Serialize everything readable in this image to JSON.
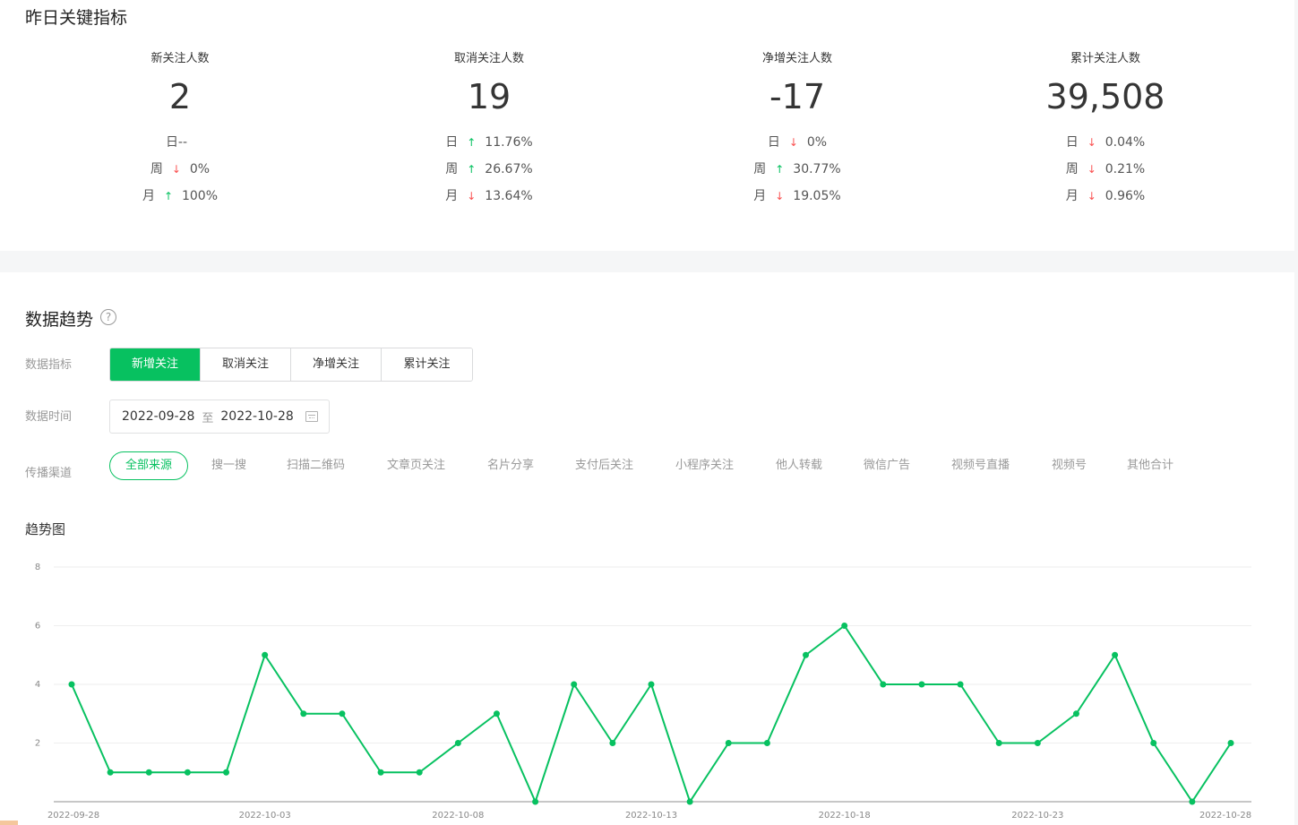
{
  "top": {
    "title": "昨日关键指标",
    "kpis": [
      {
        "label": "新关注人数",
        "value": "2",
        "rows": [
          {
            "period": "日--",
            "dir": "",
            "pct": ""
          },
          {
            "period": "周",
            "dir": "down",
            "pct": "0%"
          },
          {
            "period": "月",
            "dir": "up",
            "pct": "100%"
          }
        ]
      },
      {
        "label": "取消关注人数",
        "value": "19",
        "rows": [
          {
            "period": "日",
            "dir": "up",
            "pct": "11.76%"
          },
          {
            "period": "周",
            "dir": "up",
            "pct": "26.67%"
          },
          {
            "period": "月",
            "dir": "down",
            "pct": "13.64%"
          }
        ]
      },
      {
        "label": "净增关注人数",
        "value": "-17",
        "rows": [
          {
            "period": "日",
            "dir": "down",
            "pct": "0%"
          },
          {
            "period": "周",
            "dir": "up",
            "pct": "30.77%"
          },
          {
            "period": "月",
            "dir": "down",
            "pct": "19.05%"
          }
        ]
      },
      {
        "label": "累计关注人数",
        "value": "39,508",
        "rows": [
          {
            "period": "日",
            "dir": "down",
            "pct": "0.04%"
          },
          {
            "period": "周",
            "dir": "down",
            "pct": "0.21%"
          },
          {
            "period": "月",
            "dir": "down",
            "pct": "0.96%"
          }
        ]
      }
    ]
  },
  "trend": {
    "title": "数据趋势",
    "help_icon": "question-circle-icon",
    "metric_label": "数据指标",
    "metrics": [
      "新增关注",
      "取消关注",
      "净增关注",
      "累计关注"
    ],
    "active_metric": 0,
    "time_label": "数据时间",
    "date_start": "2022-09-28",
    "date_sep": "至",
    "date_end": "2022-10-28",
    "calendar_icon": "calendar-icon",
    "channel_label": "传播渠道",
    "channels": [
      "全部来源",
      "搜一搜",
      "扫描二维码",
      "文章页关注",
      "名片分享",
      "支付后关注",
      "小程序关注",
      "他人转载",
      "微信广告",
      "视频号直播",
      "视频号",
      "其他合计"
    ],
    "active_channel": 0,
    "chart_title": "趋势图"
  },
  "colors": {
    "accent": "#07c160",
    "up": "#07c160",
    "down": "#fa5151"
  },
  "chart_data": {
    "type": "line",
    "x": [
      "2022-09-28",
      "2022-09-29",
      "2022-09-30",
      "2022-10-01",
      "2022-10-02",
      "2022-10-03",
      "2022-10-04",
      "2022-10-05",
      "2022-10-06",
      "2022-10-07",
      "2022-10-08",
      "2022-10-09",
      "2022-10-10",
      "2022-10-11",
      "2022-10-12",
      "2022-10-13",
      "2022-10-14",
      "2022-10-15",
      "2022-10-16",
      "2022-10-17",
      "2022-10-18",
      "2022-10-19",
      "2022-10-20",
      "2022-10-21",
      "2022-10-22",
      "2022-10-23",
      "2022-10-24",
      "2022-10-25",
      "2022-10-26",
      "2022-10-27",
      "2022-10-28"
    ],
    "series": [
      {
        "values": [
          4,
          1,
          1,
          1,
          1,
          5,
          3,
          3,
          1,
          1,
          2,
          3,
          0,
          4,
          2,
          4,
          0,
          2,
          2,
          5,
          6,
          4,
          4,
          4,
          2,
          2,
          3,
          5,
          2,
          0,
          2
        ]
      }
    ],
    "x_tick_labels": [
      "2022-09-28",
      "2022-10-03",
      "2022-10-08",
      "2022-10-13",
      "2022-10-18",
      "2022-10-23",
      "2022-10-28"
    ],
    "y_ticks": [
      2,
      4,
      6,
      8
    ],
    "ylim": [
      0,
      8
    ],
    "grid": true,
    "title": "趋势图",
    "xlabel": "",
    "ylabel": ""
  }
}
